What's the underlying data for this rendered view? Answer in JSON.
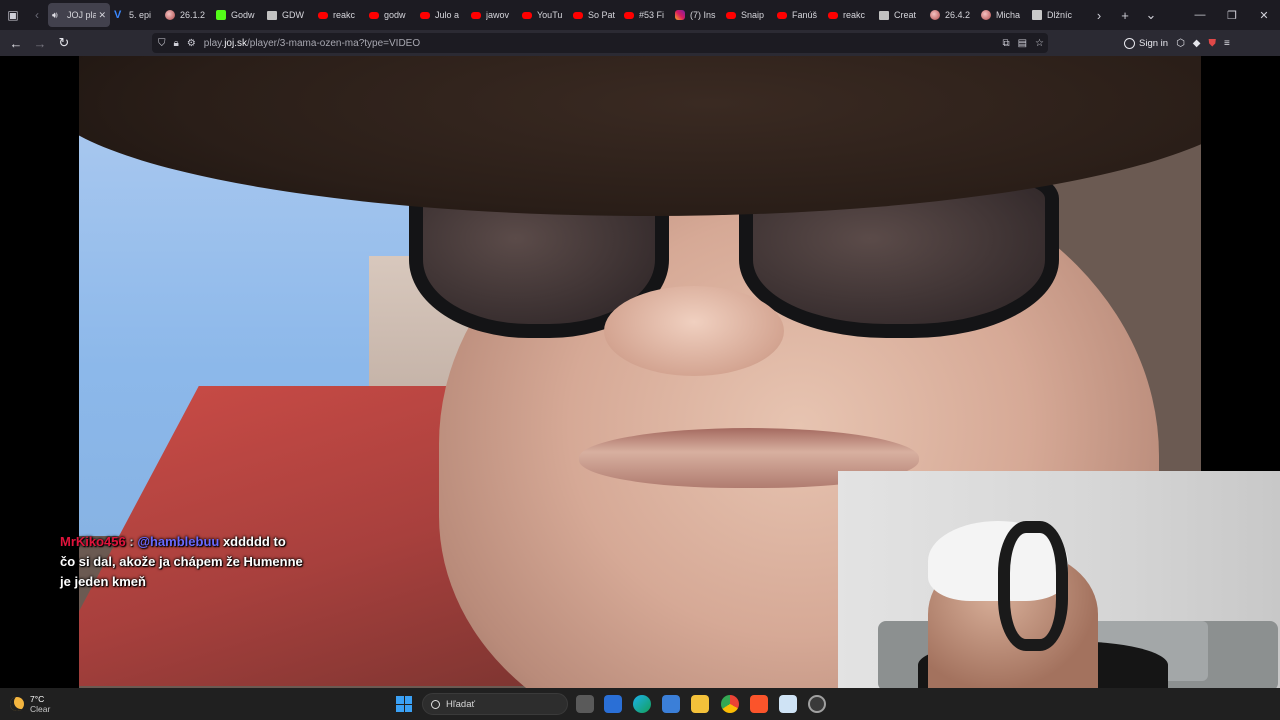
{
  "browser": {
    "tabs": [
      {
        "label": "JOJ play",
        "fav": "speaker",
        "active": true
      },
      {
        "label": "5. epi",
        "fav": "v"
      },
      {
        "label": "26.1.2",
        "fav": "avatar"
      },
      {
        "label": "Godw",
        "fav": "k"
      },
      {
        "label": "GDW",
        "fav": "spark"
      },
      {
        "label": "reakc",
        "fav": "yt"
      },
      {
        "label": "godw",
        "fav": "yt"
      },
      {
        "label": "Julo a",
        "fav": "yt"
      },
      {
        "label": "jawov",
        "fav": "yt"
      },
      {
        "label": "YouTu",
        "fav": "yt"
      },
      {
        "label": "So Pat",
        "fav": "yt"
      },
      {
        "label": "#53 Fi",
        "fav": "yt"
      },
      {
        "label": "(7) Ins",
        "fav": "ig"
      },
      {
        "label": "Snaip",
        "fav": "yt"
      },
      {
        "label": "Fanúš",
        "fav": "yt"
      },
      {
        "label": "reakc",
        "fav": "yt"
      },
      {
        "label": "Creat",
        "fav": "spark"
      },
      {
        "label": "26.4.2",
        "fav": "avatar"
      },
      {
        "label": "Micha",
        "fav": "avatar"
      },
      {
        "label": "Dlžníc",
        "fav": "doc"
      }
    ],
    "url_prefix": "play.",
    "url_domain": "joj.sk",
    "url_path": "/player/3-mama-ozen-ma?type=VIDEO",
    "sign_in": "Sign in"
  },
  "chat": {
    "user": "MrKiko456",
    "colon": " : ",
    "mention": "@hamblebuu",
    "text1": " xddddd to",
    "text2": "čo si dal, akože ja chápem že Humenne",
    "text3": "je jeden kmeň"
  },
  "taskbar": {
    "temp": "7°C",
    "condition": "Clear",
    "search_placeholder": "Hľadať"
  }
}
